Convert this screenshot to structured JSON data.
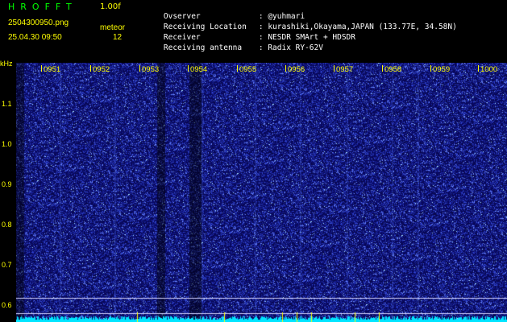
{
  "header": {
    "app_title": "HROFFT",
    "app_version": "1.00f",
    "file_name": "2504300950.png",
    "mode_label": "meteor",
    "timestamp": "25.04.30 09:50",
    "count": "12",
    "info": [
      {
        "label": "Ovserver",
        "value": ": @yuhmari"
      },
      {
        "label": "Receiving Location",
        "value": ": kurashiki,Okayama,JAPAN (133.77E, 34.58N)"
      },
      {
        "label": "Receiver",
        "value": ": NESDR SMArt + HDSDR"
      },
      {
        "label": "Receiving antenna",
        "value": ": Radix RY-62V"
      }
    ]
  },
  "spectrogram": {
    "unit": "kHz",
    "y_ticks": [
      "1.1",
      "1.0",
      "0.9",
      "0.8",
      "0.7",
      "0.6"
    ],
    "time_labels": [
      "0951",
      "0952",
      "0953",
      "0954",
      "0955",
      "0956",
      "0957",
      "0958",
      "0959",
      "1000"
    ],
    "colors": {
      "background": "#0a0a5a",
      "noise": "#3a4aff",
      "baseline": "#00e5ff",
      "axis_text": "#ffff00"
    }
  }
}
